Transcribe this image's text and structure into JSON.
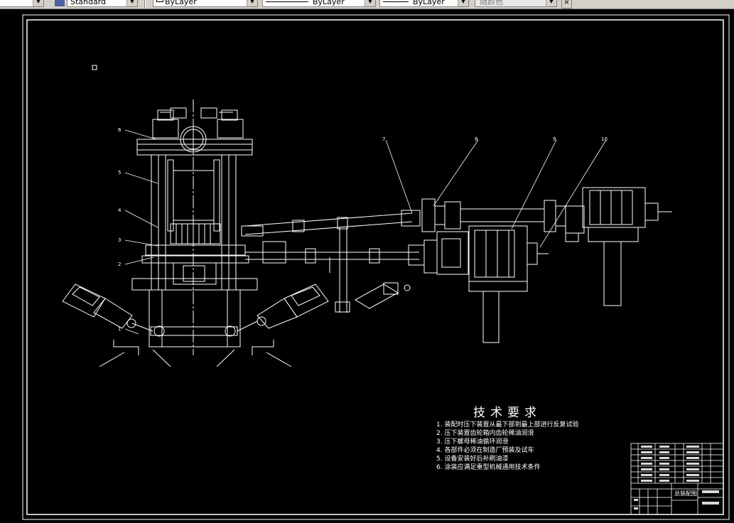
{
  "toolbar": {
    "text_style": "Standard",
    "layer": "ByLayer",
    "linetype": "ByLayer",
    "lineweight": "ByLayer",
    "plot_style": "随颜色"
  },
  "balloons": [
    "6",
    "5",
    "4",
    "3",
    "2",
    "1",
    "7",
    "8",
    "9",
    "10"
  ],
  "tech": {
    "title": "技术要求",
    "items": [
      "1. 装配时压下装置从最下部到最上部进行反复试验",
      "2. 压下装置齿轮箱内齿轮稀油润滑",
      "3. 压下螺母稀油循环润滑",
      "4. 各部件必须在制造厂预装及试车",
      "5. 设备安装好后补刷油漆",
      "6. 涂装应满足重型机械通用技术条件"
    ]
  },
  "titleblock": {
    "title": "总装配图"
  },
  "colors": {
    "background": "#000000",
    "lines": "#ffffff",
    "toolbar": "#d4d0c8"
  }
}
